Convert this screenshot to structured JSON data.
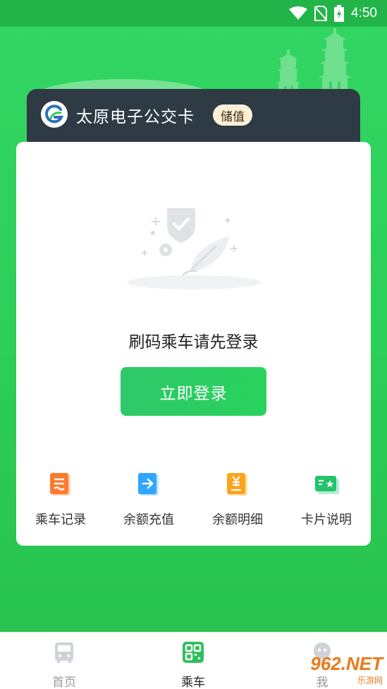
{
  "status_bar": {
    "time": "4:50"
  },
  "card": {
    "brand_title": "太原电子公交卡",
    "recharge_badge": "储值"
  },
  "main": {
    "login_prompt": "刷码乘车请先登录",
    "login_button": "立即登录"
  },
  "features": [
    {
      "label": "乘车记录",
      "icon": "ride-record-icon",
      "color": "#ff7a2e"
    },
    {
      "label": "余额充值",
      "icon": "balance-recharge-icon",
      "color": "#2fa6ff"
    },
    {
      "label": "余额明细",
      "icon": "balance-detail-icon",
      "color": "#ffa31a"
    },
    {
      "label": "卡片说明",
      "icon": "card-info-icon",
      "color": "#22c46d"
    }
  ],
  "bottom_nav": {
    "items": [
      {
        "label": "首页",
        "icon": "bus-icon",
        "active": false
      },
      {
        "label": "乘车",
        "icon": "qr-code-icon",
        "active": true
      },
      {
        "label": "我",
        "icon": "profile-icon",
        "active": false
      }
    ]
  },
  "watermark": {
    "main": "962.NET",
    "sub": "乐游网"
  },
  "colors": {
    "primary": "#2fcf5a",
    "dark_card": "#2e3b45",
    "badge_bg": "#fdf0d6"
  }
}
